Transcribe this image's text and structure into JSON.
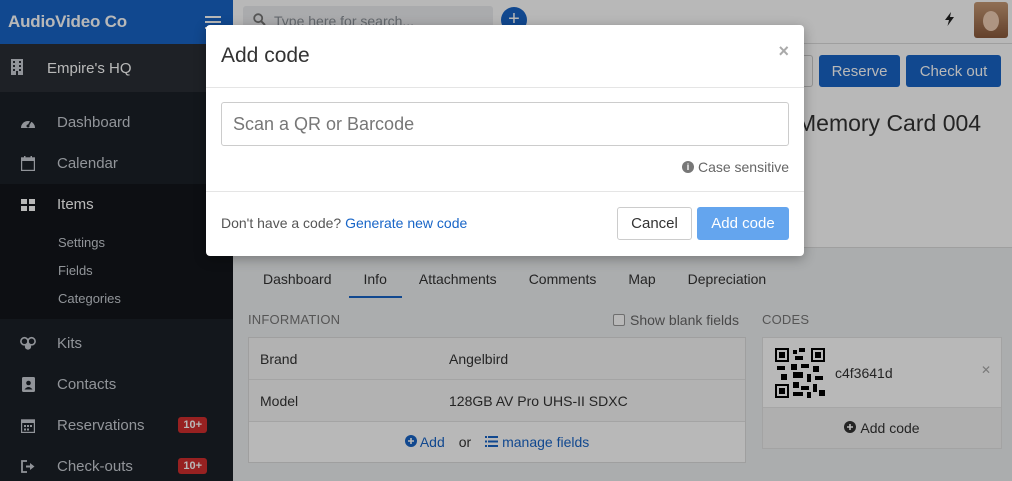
{
  "app": {
    "brand": "AudioVideo Co"
  },
  "sidebar": {
    "org": "Empire's HQ",
    "items": [
      {
        "label": "Dashboard",
        "icon": "dashboard-icon"
      },
      {
        "label": "Calendar",
        "icon": "calendar-icon"
      },
      {
        "label": "Items",
        "icon": "grid-icon"
      },
      {
        "label": "Kits",
        "icon": "kits-icon"
      },
      {
        "label": "Contacts",
        "icon": "contacts-icon"
      },
      {
        "label": "Reservations",
        "icon": "reservations-icon",
        "badge": "10+"
      },
      {
        "label": "Check-outs",
        "icon": "checkout-icon",
        "badge": "10+"
      }
    ],
    "subitems": [
      "Settings",
      "Fields",
      "Categories"
    ]
  },
  "topbar": {
    "search_placeholder": "Type here for search..."
  },
  "item": {
    "title": "Memory Card 004",
    "reserve_label": "Reserve",
    "checkout_label": "Check out"
  },
  "tabs": [
    "Dashboard",
    "Info",
    "Attachments",
    "Comments",
    "Map",
    "Depreciation"
  ],
  "active_tab": "Info",
  "information": {
    "label": "INFORMATION",
    "show_blank_label": "Show blank fields",
    "rows": [
      {
        "key": "Brand",
        "value": "Angelbird"
      },
      {
        "key": "Model",
        "value": "128GB AV Pro UHS-II SDXC"
      }
    ],
    "add_label": "Add",
    "or_label": "or",
    "manage_label": "manage fields"
  },
  "codes": {
    "label": "CODES",
    "items": [
      {
        "value": "c4f3641d"
      }
    ],
    "add_label": "Add code"
  },
  "modal": {
    "title": "Add code",
    "close": "×",
    "input_placeholder": "Scan a QR or Barcode",
    "case_note": "Case sensitive",
    "no_code_text": "Don't have a code?",
    "generate_link": "Generate new code",
    "cancel_label": "Cancel",
    "add_label": "Add code"
  },
  "colors": {
    "accent": "#1865c7",
    "sidebar_bg": "#1b2027",
    "badge": "#d12e2e",
    "add_button_disabled": "#64a5ee"
  }
}
